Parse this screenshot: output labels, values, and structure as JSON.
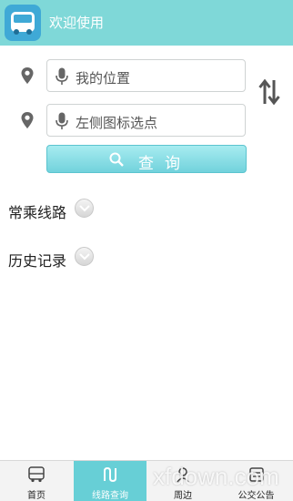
{
  "header": {
    "title": "欢迎使用"
  },
  "route_form": {
    "start_text": "我的位置",
    "end_text": "左侧图标选点",
    "query_label": "查询"
  },
  "sections": [
    {
      "label": "常乘线路"
    },
    {
      "label": "历史记录"
    }
  ],
  "tabbar": {
    "tabs": [
      {
        "label": "首页",
        "icon": "bus-icon"
      },
      {
        "label": "线路查询",
        "icon": "route-icon",
        "active": true
      },
      {
        "label": "周边",
        "icon": "nearby-icon"
      },
      {
        "label": "公交公告",
        "icon": "notice-icon"
      }
    ]
  },
  "watermark": "xfdown.com",
  "colors": {
    "header": "#7fd8d8",
    "accent": "#67cfd6",
    "button": "#72d2dc"
  }
}
